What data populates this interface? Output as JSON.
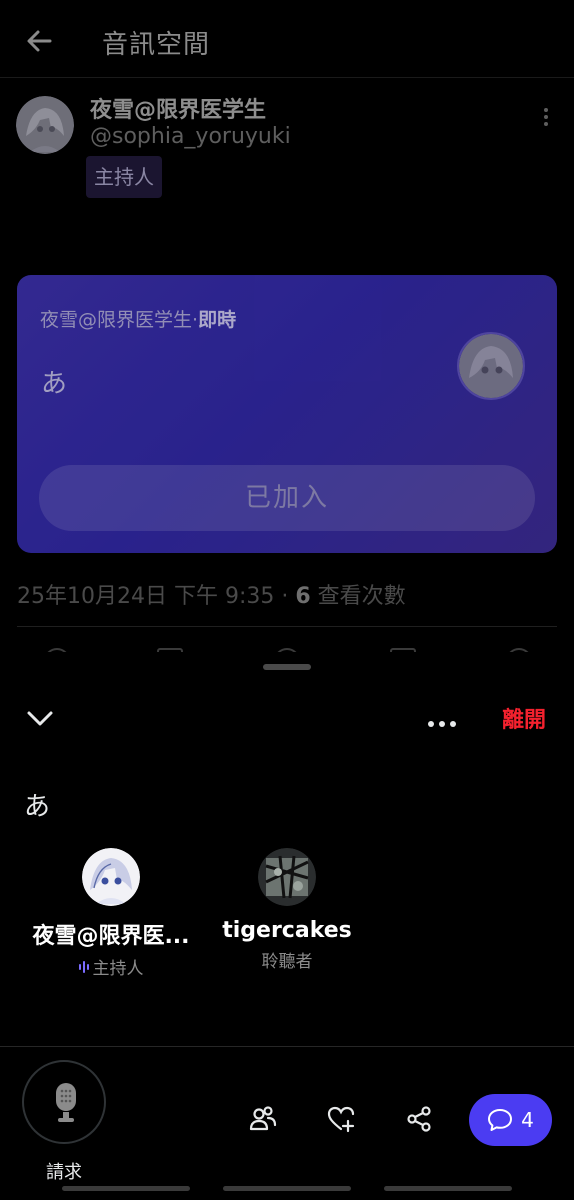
{
  "header": {
    "title": "音訊空間"
  },
  "post": {
    "author_name": "夜雪@限界医学生",
    "author_handle": "@sophia_yoruyuki",
    "role_tag": "主持人",
    "timestamp": "25年10月24日 下午 9:35 · ",
    "view_count": "6",
    "view_label": " 查看次數"
  },
  "space_card": {
    "host": "夜雪@限界医学生",
    "dot": "·",
    "status": "即時",
    "title": "あ",
    "button_label": "已加入"
  },
  "sheet": {
    "leave_label": "離開",
    "space_title": "あ",
    "participants": [
      {
        "name": "夜雪@限界医...",
        "role": "主持人"
      },
      {
        "name": "tigercakes",
        "role": "聆聽者"
      }
    ],
    "request_label": "請求",
    "chat_count": "4"
  },
  "colors": {
    "accent": "#4b3cf2",
    "leave": "#f4212e",
    "card": "#3a2fa4"
  }
}
